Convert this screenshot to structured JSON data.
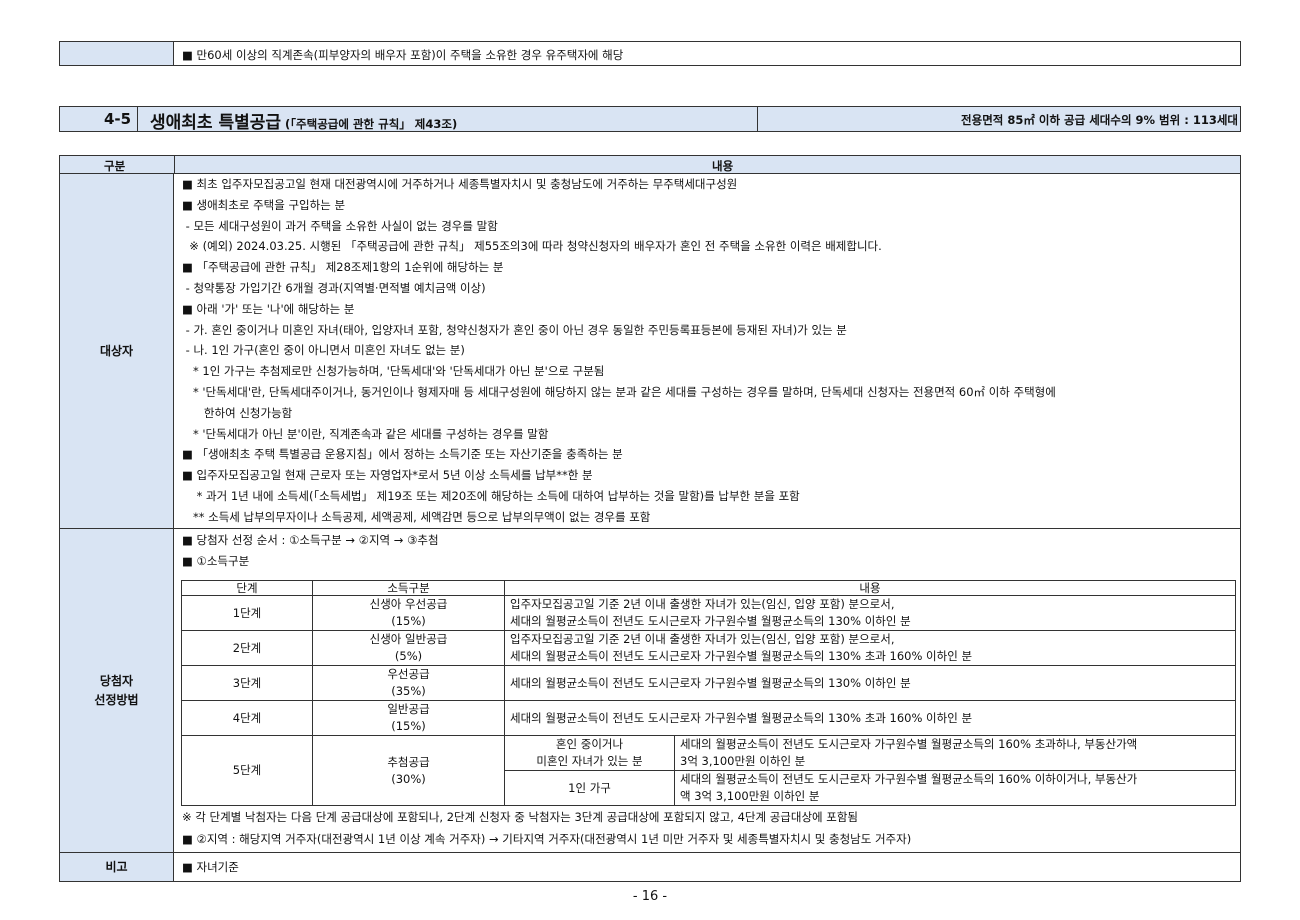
{
  "top_row": {
    "text": "■ 만60세 이상의 직계존속(피부양자의 배우자 포함)이 주택을 소유한 경우 유주택자에 해당"
  },
  "section": {
    "number": "4-5",
    "title": "생애최초 특별공급",
    "reference": "(「주택공급에 관한 규칙」 제43조)",
    "quota": "전용면적 85㎡ 이하 공급 세대수의 9% 범위 : 113세대"
  },
  "main_table": {
    "header_label": "구분",
    "header_content": "내용",
    "eligibility": {
      "label": "대상자",
      "lines": [
        "■ 최초 입주자모집공고일 현재 대전광역시에 거주하거나 세종특별자치시 및 충청남도에 거주하는 무주택세대구성원",
        "■ 생애최초로 주택을 구입하는 분",
        " - 모든 세대구성원이 과거 주택을 소유한 사실이 없는 경우를 말함",
        "  ※ (예외) 2024.03.25. 시행된 「주택공급에 관한 규칙」 제55조의3에 따라 청약신청자의 배우자가 혼인 전 주택을 소유한 이력은 배제합니다.",
        "■ 「주택공급에 관한 규칙」 제28조제1항의 1순위에 해당하는 분",
        " - 청약통장 가입기간 6개월 경과(지역별·면적별 예치금액 이상)",
        "■ 아래 '가' 또는 '나'에 해당하는 분",
        " - 가. 혼인 중이거나 미혼인 자녀(태아, 입양자녀 포함, 청약신청자가 혼인 중이 아닌 경우 동일한 주민등록표등본에 등재된 자녀)가 있는 분",
        " - 나. 1인 가구(혼인 중이 아니면서 미혼인 자녀도 없는 분)",
        "   * 1인 가구는 추첨제로만 신청가능하며, '단독세대'와 '단독세대가 아닌 분'으로 구분됨",
        "   * '단독세대'란, 단독세대주이거나, 동거인이나 형제자매 등 세대구성원에 해당하지 않는 분과 같은 세대를 구성하는 경우를 말하며, 단독세대 신청자는 전용면적 60㎡ 이하 주택형에",
        "      한하여 신청가능함",
        "   * '단독세대가 아닌 분'이란, 직계존속과 같은 세대를 구성하는 경우를 말함",
        "■ 「생애최초 주택 특별공급 운용지침」에서 정하는 소득기준 또는 자산기준을 충족하는 분",
        "■ 입주자모집공고일 현재 근로자 또는 자영업자*로서 5년 이상 소득세를 납부**한 분",
        "    * 과거 1년 내에 소득세(「소득세법」 제19조 또는 제20조에 해당하는 소득에 대하여 납부하는 것을 말함)를 납부한 분을 포함",
        "   ** 소득세 납부의무자이나 소득공제, 세액공제, 세액감면 등으로 납부의무액이 없는 경우를 포함"
      ]
    },
    "selection": {
      "label_line1": "당첨자",
      "label_line2": "선정방법",
      "order_line": "■ 당첨자 선정 순서 : ①소득구분 → ②지역 → ③추첨",
      "income_heading": "■ ①소득구분",
      "inner_table": {
        "headers": [
          "단계",
          "소득구분",
          "내용"
        ],
        "rows": [
          {
            "stage": "1단계",
            "type_line1": "신생아 우선공급",
            "type_line2": "(15%)",
            "content_line1": "입주자모집공고일 기준 2년 이내 출생한 자녀가 있는(임신, 입양 포함) 분으로서,",
            "content_line2": "세대의 월평균소득이 전년도 도시근로자 가구원수별 월평균소득의 130% 이하인 분"
          },
          {
            "stage": "2단계",
            "type_line1": "신생아 일반공급",
            "type_line2": "(5%)",
            "content_line1": "입주자모집공고일 기준 2년 이내 출생한 자녀가 있는(임신, 입양 포함) 분으로서,",
            "content_line2": "세대의 월평균소득이 전년도 도시근로자 가구원수별 월평균소득의 130% 초과 160% 이하인 분"
          },
          {
            "stage": "3단계",
            "type_line1": "우선공급",
            "type_line2": "(35%)",
            "content_line1": "세대의 월평균소득이 전년도 도시근로자 가구원수별 월평균소득의 130% 이하인 분"
          },
          {
            "stage": "4단계",
            "type_line1": "일반공급",
            "type_line2": "(15%)",
            "content_line1": "세대의 월평균소득이 전년도 도시근로자 가구원수별 월평균소득의 130% 초과 160% 이하인 분"
          }
        ],
        "stage5": {
          "stage": "5단계",
          "type_line1": "추첨공급",
          "type_line2": "(30%)",
          "sub_a_line1": "혼인 중이거나",
          "sub_a_line2": "미혼인 자녀가 있는 분",
          "sub_a_content_line1": "세대의 월평균소득이 전년도 도시근로자 가구원수별 월평균소득의 160% 초과하나, 부동산가액",
          "sub_a_content_line2": "3억 3,100만원 이하인 분",
          "sub_b": "1인 가구",
          "sub_b_content_line1": "세대의 월평균소득이 전년도 도시근로자 가구원수별 월평균소득의 160% 이하이거나, 부동산가",
          "sub_b_content_line2": "액 3억 3,100만원 이하인 분"
        }
      },
      "note_line": "※ 각 단계별 낙첨자는 다음 단계 공급대상에 포함되나, 2단계 신청자 중 낙첨자는 3단계 공급대상에 포함되지 않고, 4단계 공급대상에 포함됨",
      "region_line": "■ ②지역 : 해당지역 거주자(대전광역시 1년 이상 계속 거주자) → 기타지역 거주자(대전광역시 1년 미만 거주자 및 세종특별자치시 및 충청남도 거주자)"
    },
    "remarks": {
      "label": "비고",
      "text": "■ 자녀기준"
    }
  },
  "page_number": "- 16 -"
}
